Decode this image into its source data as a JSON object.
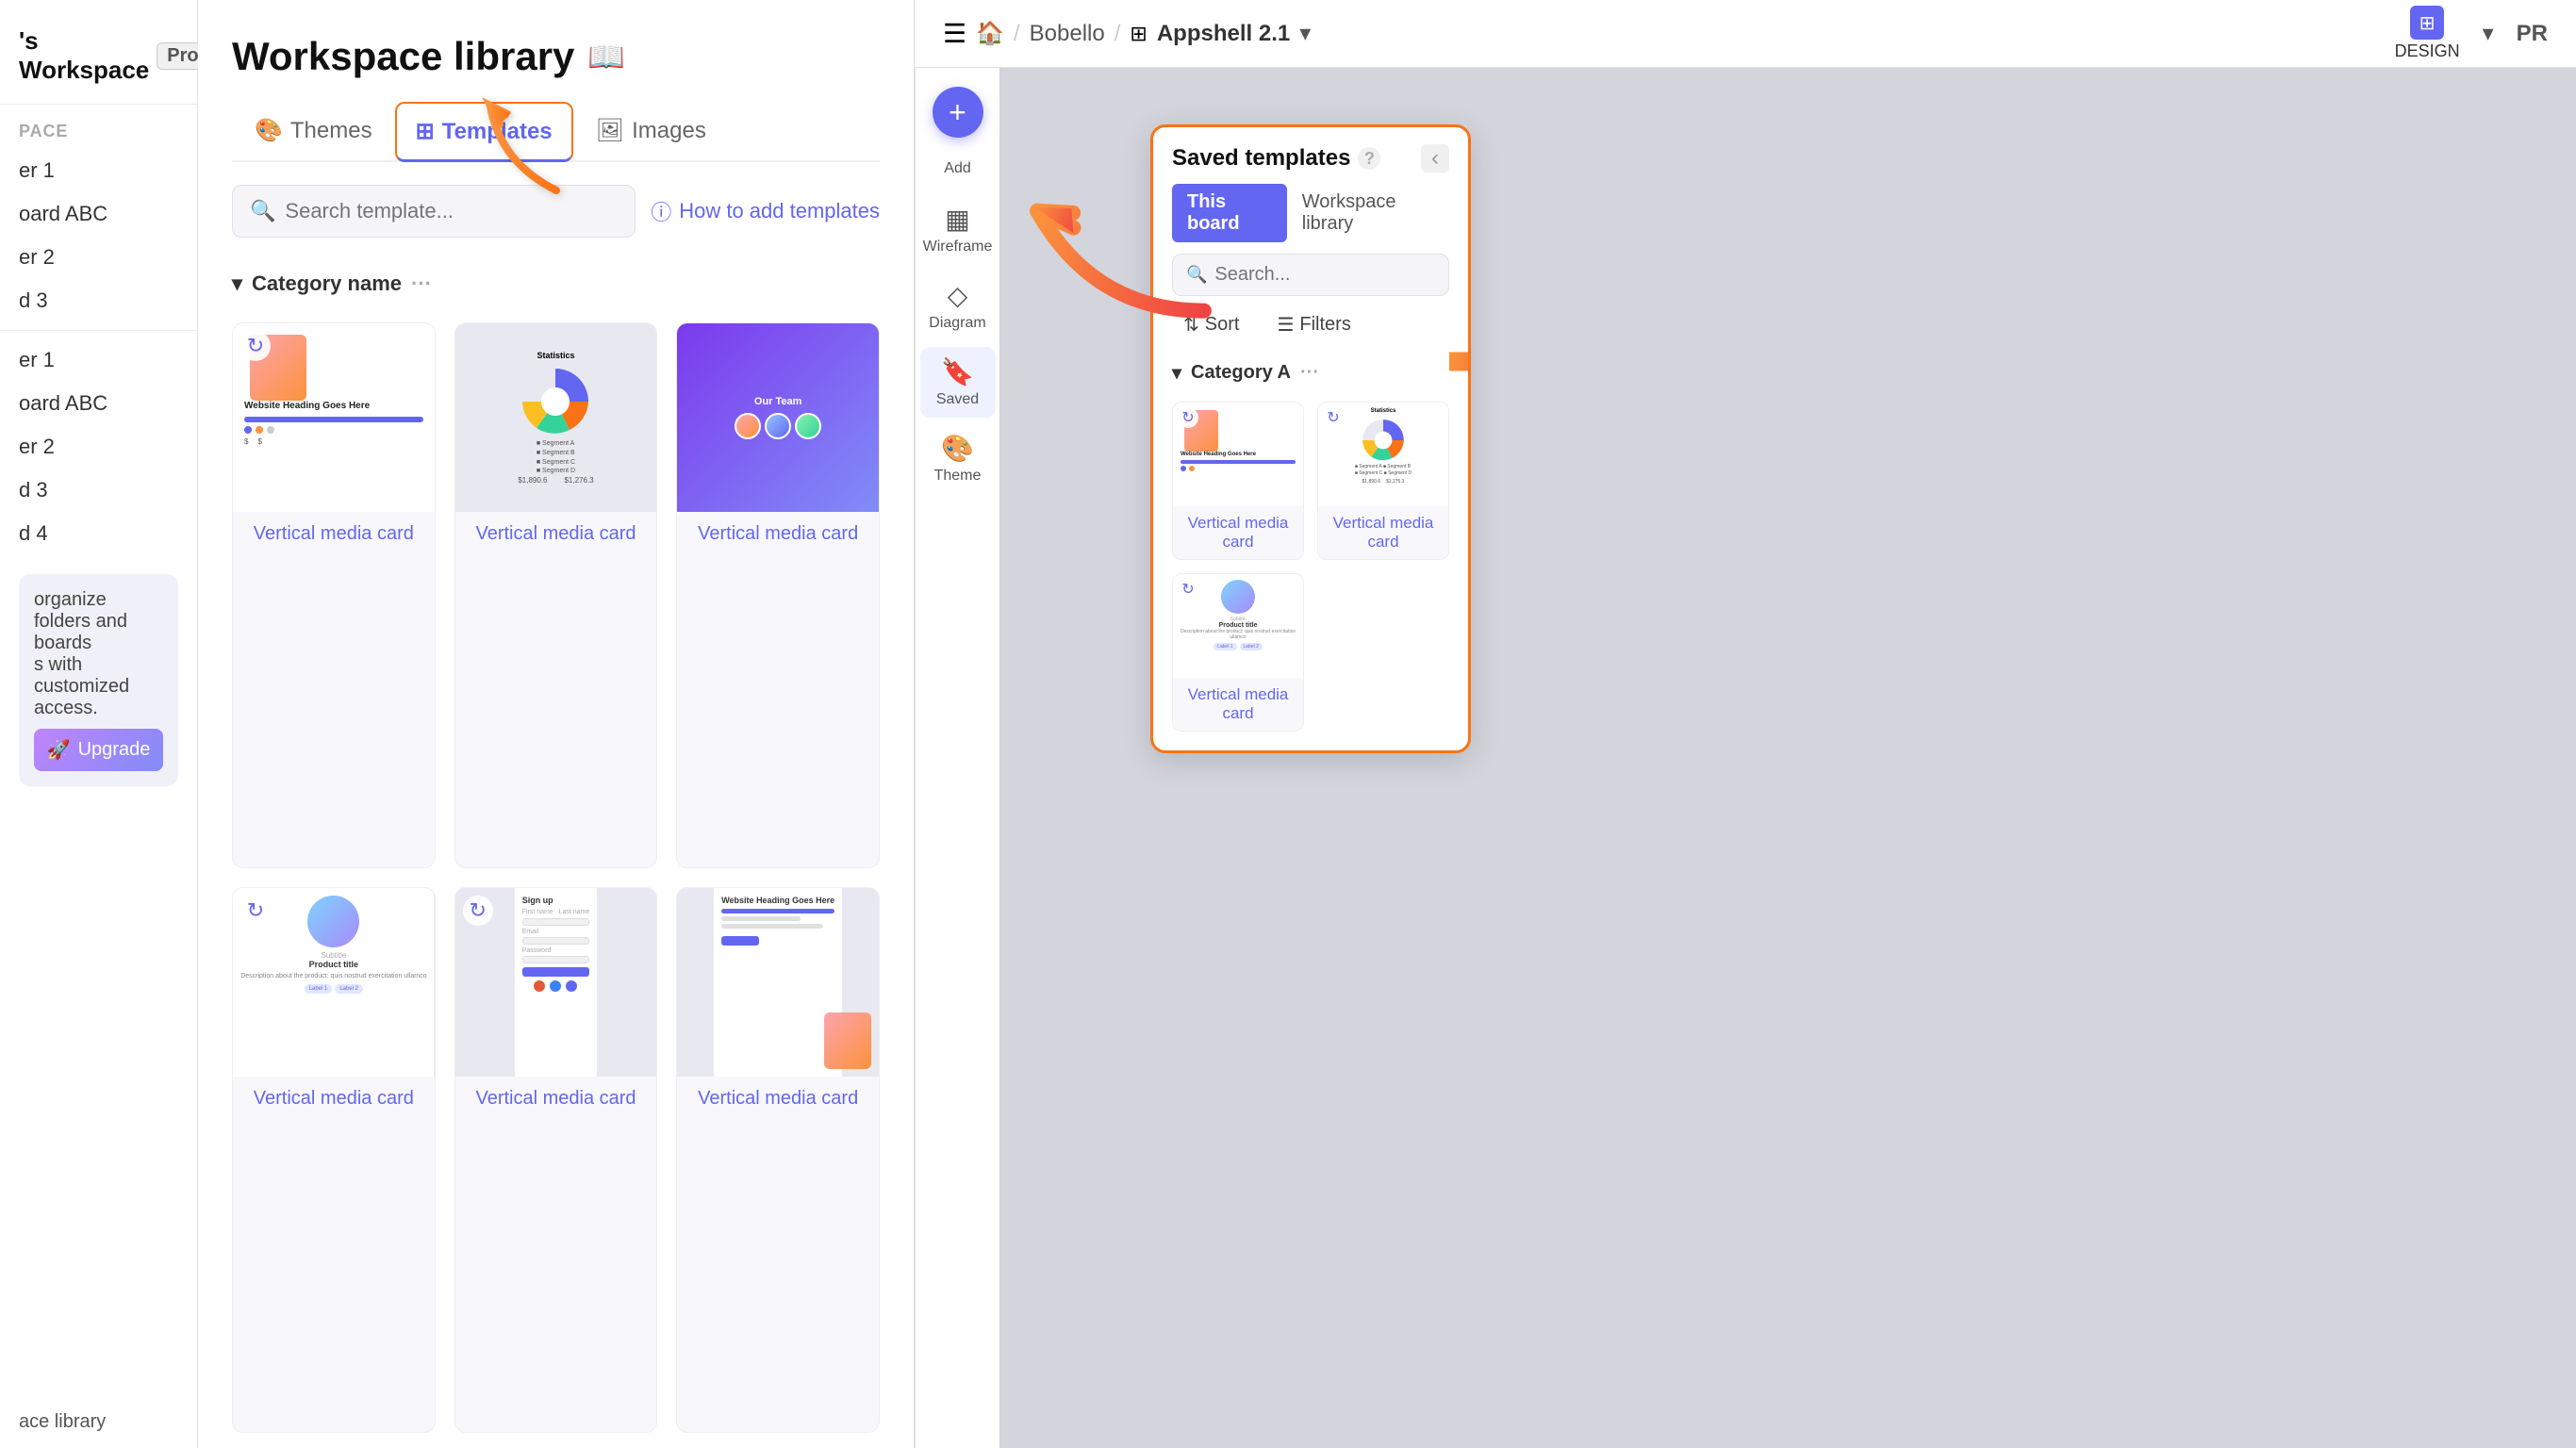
{
  "sidebar": {
    "workspace_name": "'s Workspace",
    "pro_label": "Pro",
    "sections": [
      {
        "label": "PACE"
      },
      {
        "item": "er 1"
      },
      {
        "item": "oard ABC"
      },
      {
        "item": "er 2"
      },
      {
        "item": "d 3"
      }
    ],
    "sections2": [
      {
        "item": "er 1"
      },
      {
        "item": "oard ABC"
      },
      {
        "item": "er 2"
      },
      {
        "item": "d 3"
      },
      {
        "item": "d 4"
      }
    ],
    "upgrade_text": "organize folders and boards\ns with customized access.",
    "upgrade_btn": "Upgrade",
    "footer_link": "ace library"
  },
  "library": {
    "title": "Workspace library",
    "tabs": [
      {
        "id": "themes",
        "label": "Themes",
        "icon": "🎨"
      },
      {
        "id": "templates",
        "label": "Templates",
        "icon": "⊞"
      },
      {
        "id": "images",
        "label": "Images",
        "icon": "🖼"
      }
    ],
    "search_placeholder": "Search template...",
    "how_to_link": "How to add templates",
    "category_name": "Category name",
    "template_label": "Vertical media card",
    "templates": [
      {
        "id": 1,
        "label": "Vertical media card",
        "type": "person"
      },
      {
        "id": 2,
        "label": "Vertical media card",
        "type": "stats"
      },
      {
        "id": 3,
        "label": "Vertical media card",
        "type": "team"
      },
      {
        "id": 4,
        "label": "Vertical media card",
        "type": "product"
      },
      {
        "id": 5,
        "label": "Vertical media card",
        "type": "signup"
      },
      {
        "id": 6,
        "label": "Vertical media card",
        "type": "website"
      }
    ]
  },
  "topbar": {
    "home_icon": "🏠",
    "project_name": "Bobello",
    "board_icon": "⊞",
    "board_name": "Appshell 2.1",
    "design_label": "DESIGN",
    "pr_label": "PR"
  },
  "tools": {
    "add_label": "Add",
    "wireframe_label": "Wireframe",
    "diagram_label": "Diagram",
    "saved_label": "Saved",
    "theme_label": "Theme"
  },
  "saved_panel": {
    "title": "Saved templates",
    "help_icon": "?",
    "close_icon": "‹",
    "tabs": [
      {
        "id": "this_board",
        "label": "This board",
        "active": true
      },
      {
        "id": "workspace",
        "label": "Workspace library",
        "active": false
      }
    ],
    "search_placeholder": "Search...",
    "sort_label": "Sort",
    "filters_label": "Filters",
    "category_label": "Category A",
    "cards": [
      {
        "id": 1,
        "label": "Vertical media card",
        "type": "person"
      },
      {
        "id": 2,
        "label": "Vertical media card",
        "type": "stats"
      },
      {
        "id": 3,
        "label": "Vertical media card",
        "type": "product"
      }
    ]
  },
  "colors": {
    "accent": "#6366f1",
    "orange": "#f97316",
    "red_arrow": "#e05a3a"
  }
}
